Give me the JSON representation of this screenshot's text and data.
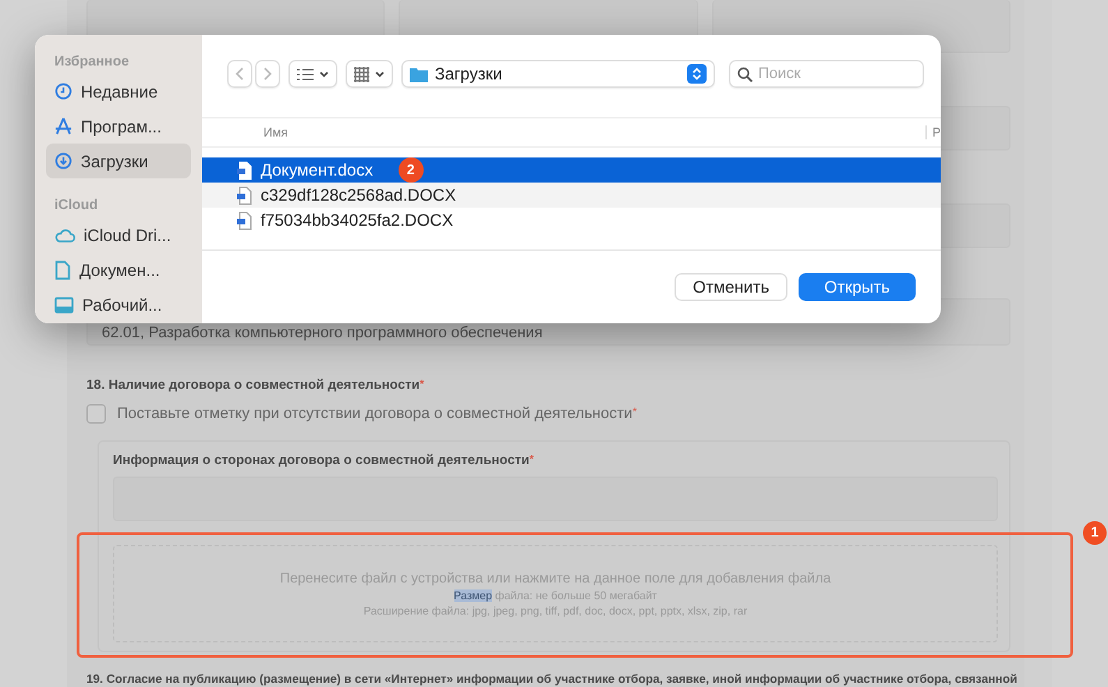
{
  "dialog": {
    "sidebar": [
      {
        "heading": "Избранное",
        "items": [
          {
            "label": "Недавние",
            "selected": false
          },
          {
            "label": "Програм...",
            "selected": false
          },
          {
            "label": "Загрузки",
            "selected": true
          }
        ]
      },
      {
        "heading": "iCloud",
        "items": [
          {
            "label": "iCloud Dri...",
            "selected": false
          },
          {
            "label": "Докумен...",
            "selected": false
          },
          {
            "label": "Рабочий...",
            "selected": false
          }
        ]
      }
    ],
    "toolbar": {
      "location": "Загрузки",
      "search_placeholder": "Поиск"
    },
    "columns": [
      "Имя",
      "Р"
    ],
    "files": [
      {
        "name": "Документ.docx",
        "selected": true,
        "badge": "2"
      },
      {
        "name": "c329df128c2568ad.DOCX",
        "selected": false
      },
      {
        "name": "f75034bb34025fa2.DOCX",
        "selected": false
      }
    ],
    "buttons": [
      {
        "label": "Отменить",
        "kind": "secondary"
      },
      {
        "label": "Открыть",
        "kind": "primary"
      }
    ]
  },
  "form": {
    "activity": "62.01, Разработка компьютерного программного обеспечения",
    "section_18": {
      "title": "18. Наличие договора о совместной деятельности",
      "mark": "*",
      "checkbox": {
        "label": "Поставьте отметку при отсутствии договора о совместной деятельности",
        "mark": "*",
        "checked": false
      }
    },
    "parties": {
      "label": "Информация о сторонах договора о совместной деятельности",
      "mark": "*"
    },
    "upload": {
      "prompt": "Перенесите файл с устройства или нажмите на данное поле для добавления файла",
      "size_selected": "Размер",
      "size_rest": " файла: не больше 50 мегабайт",
      "extensions": "Расширение файла: jpg, jpeg, png, tiff, pdf, doc, docx, ppt, pptx, xlsx, zip, rar",
      "highlighted": true,
      "badge": "1"
    },
    "section_19": {
      "title": "19. Согласие на публикацию (размещение) в сети «Интернет» информации об участнике отбора, заявке, иной информации об участнике отбора, связанной"
    }
  }
}
